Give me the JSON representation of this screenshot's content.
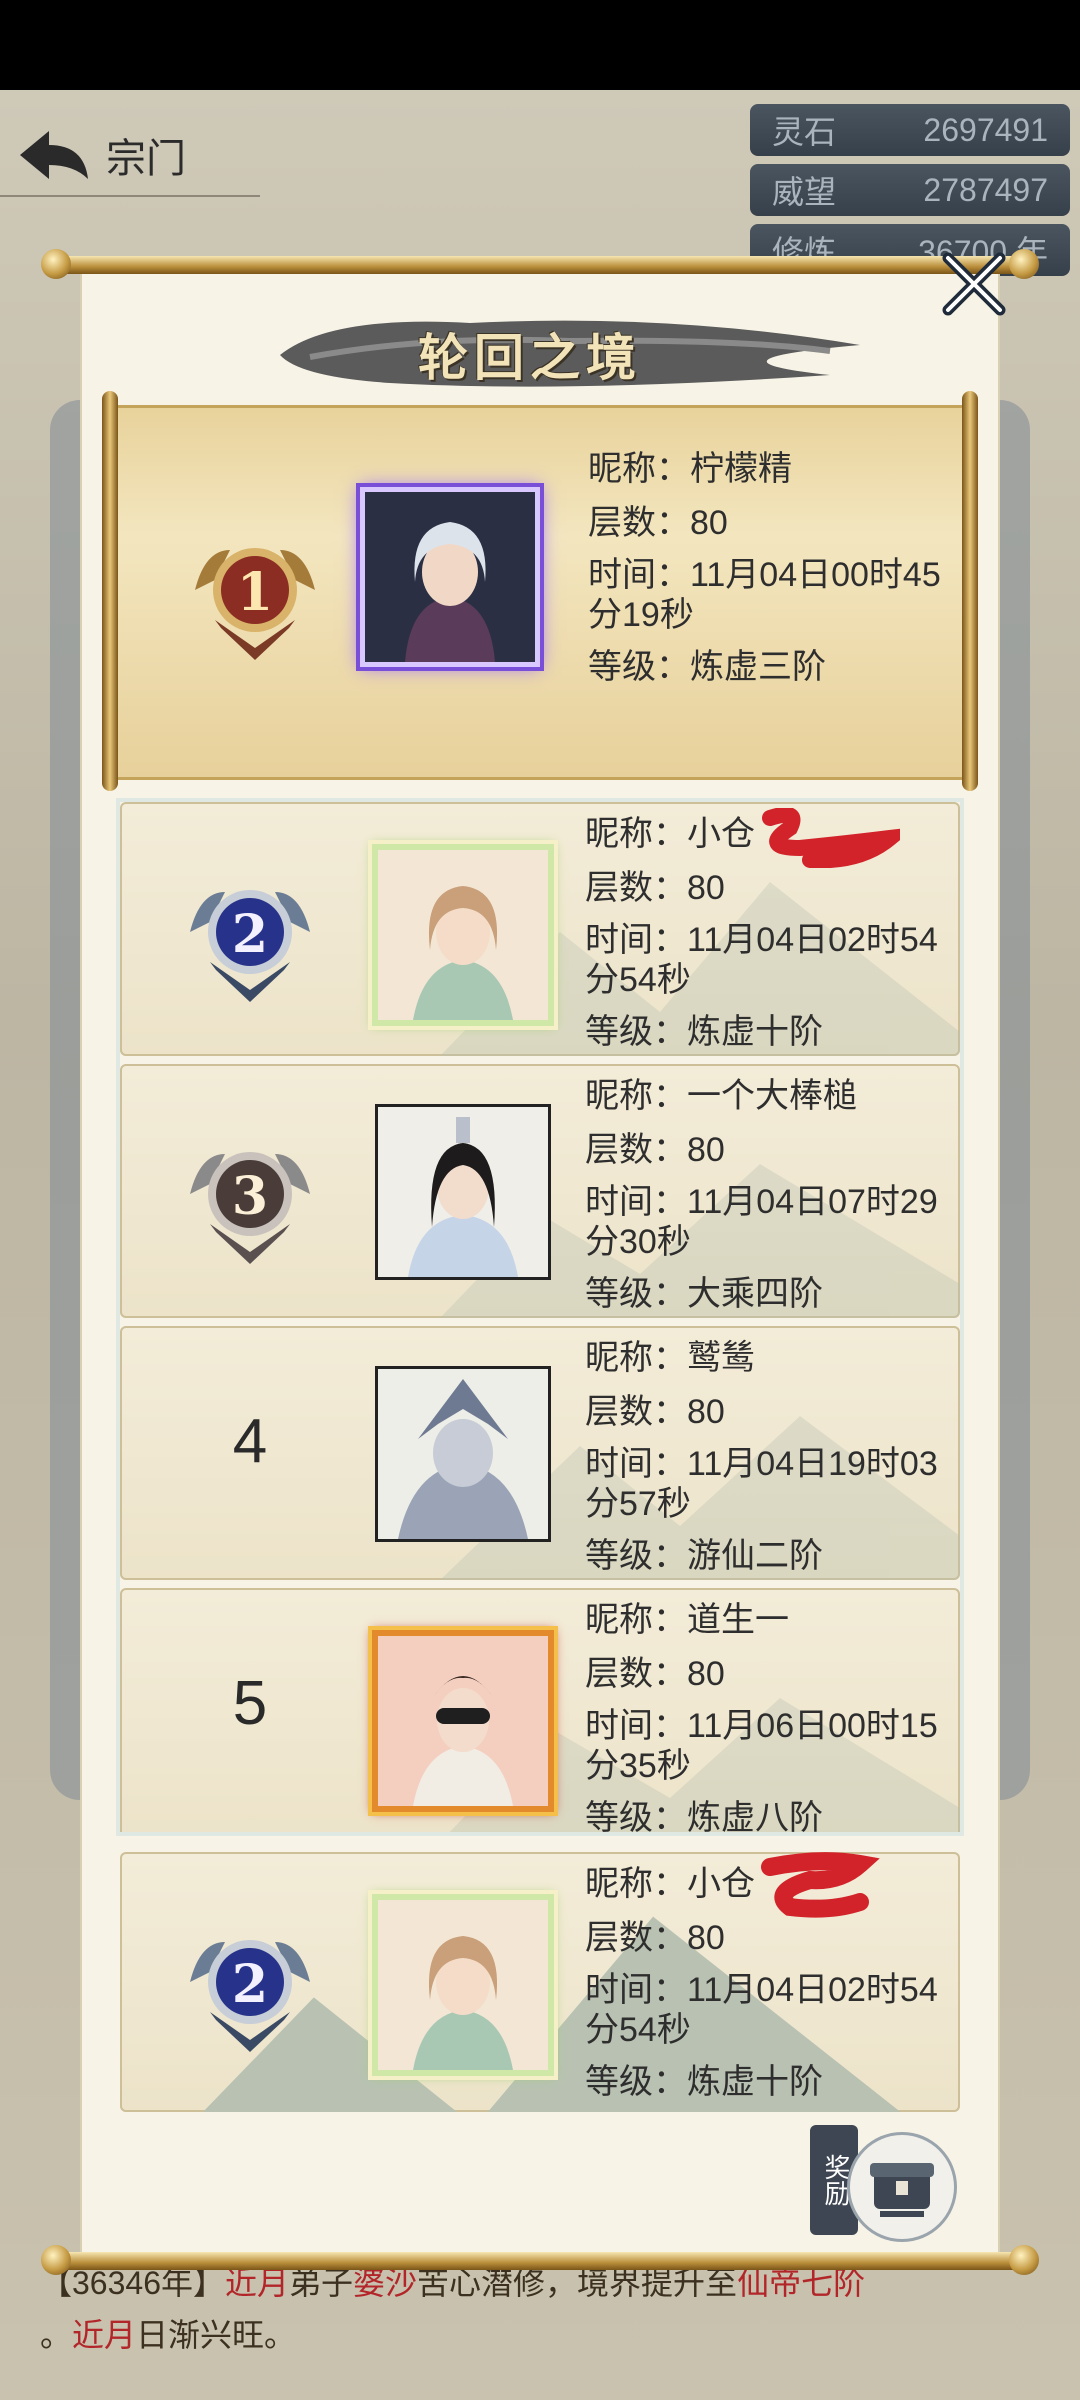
{
  "background": {
    "header_title": "宗门",
    "stats": [
      {
        "label": "灵石",
        "value": "2697491"
      },
      {
        "label": "威望",
        "value": "2787497"
      },
      {
        "label": "修炼",
        "value": "36700 年"
      }
    ],
    "footer": {
      "year": "【36346年】",
      "name1": "近月",
      "mid": "弟子",
      "name2": "婆沙",
      "text": "苦心潜修，境界提升至",
      "realm": "仙帝七阶",
      "line2_dot": "。",
      "name3": "近月",
      "line2_text": "日渐兴旺。"
    }
  },
  "modal": {
    "title": "轮回之境",
    "labels": {
      "nickname": "昵称：",
      "floors": "层数：",
      "time": "时间：",
      "level": "等级："
    },
    "entries": [
      {
        "rank": "1",
        "nickname": "柠檬精",
        "floors": "80",
        "time": "11月04日00时45分19秒",
        "level": "炼虚三阶"
      },
      {
        "rank": "2",
        "nickname": "小仓",
        "floors": "80",
        "time": "11月04日02时54分54秒",
        "level": "炼虚十阶"
      },
      {
        "rank": "3",
        "nickname": "一个大棒槌",
        "floors": "80",
        "time": "11月04日07时29分30秒",
        "level": "大乘四阶"
      },
      {
        "rank": "4",
        "nickname": "鹫鸶",
        "floors": "80",
        "time": "11月04日19时03分57秒",
        "level": "游仙二阶"
      },
      {
        "rank": "5",
        "nickname": "道生一",
        "floors": "80",
        "time": "11月06日00时15分35秒",
        "level": "炼虚八阶"
      }
    ],
    "my_entry": {
      "rank": "2",
      "nickname": "小仓",
      "floors": "80",
      "time": "11月04日02时54分54秒",
      "level": "炼虚十阶"
    },
    "reward_label": "奖励"
  }
}
